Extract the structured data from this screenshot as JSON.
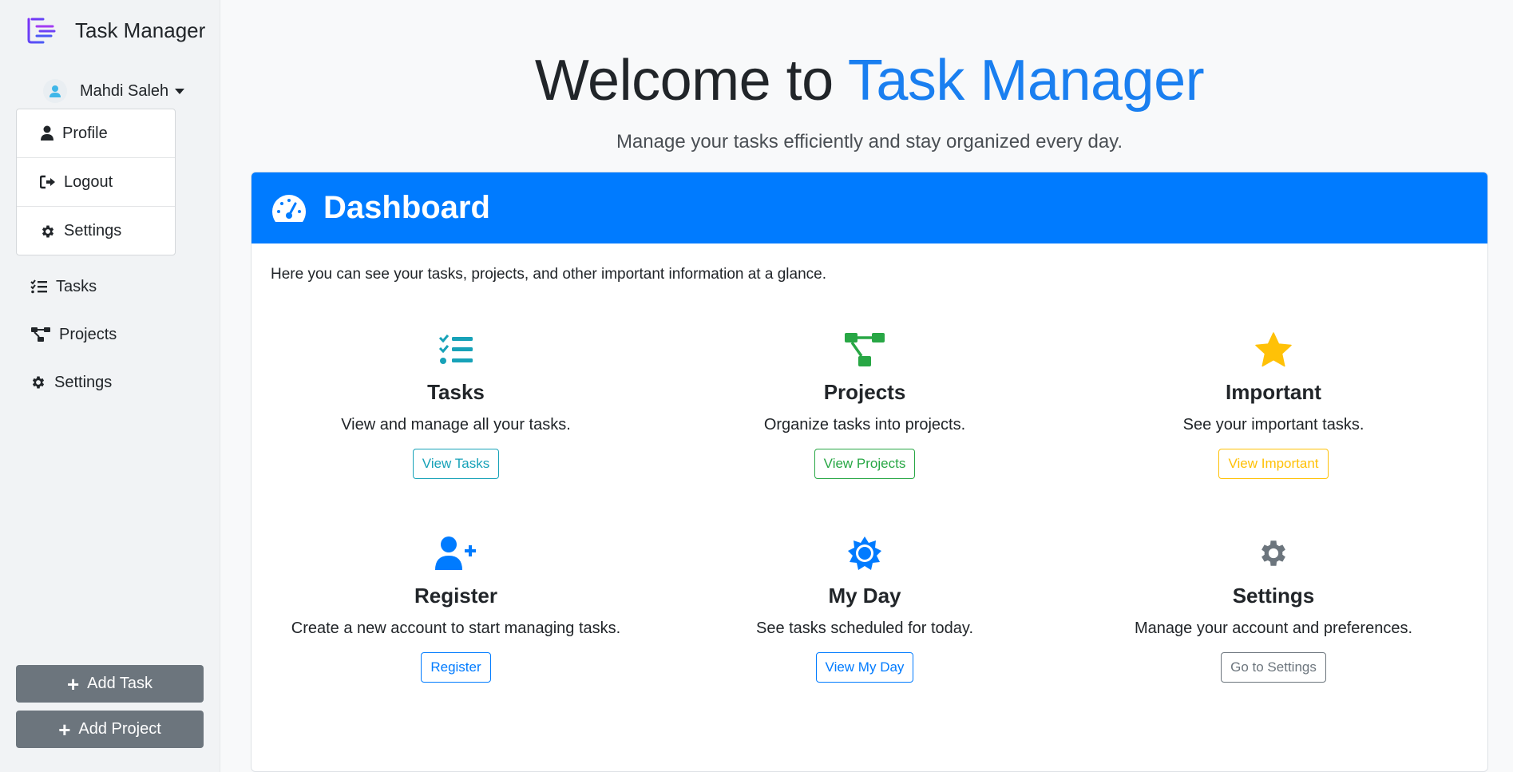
{
  "app": {
    "name": "Task Manager"
  },
  "user": {
    "name": "Mahdi Saleh"
  },
  "user_menu": [
    {
      "label": "Profile",
      "icon": "user-icon"
    },
    {
      "label": "Logout",
      "icon": "sign-out-icon"
    },
    {
      "label": "Settings",
      "icon": "gear-icon"
    }
  ],
  "nav": [
    {
      "label": "Tasks",
      "icon": "tasks-list-icon"
    },
    {
      "label": "Projects",
      "icon": "project-diagram-icon"
    },
    {
      "label": "Settings",
      "icon": "gear-icon"
    }
  ],
  "sidebar_buttons": {
    "add_task": "Add Task",
    "add_project": "Add Project"
  },
  "hero": {
    "title_prefix": "Welcome to ",
    "title_accent": "Task Manager",
    "subtitle": "Manage your tasks efficiently and stay organized every day."
  },
  "dashboard": {
    "title": "Dashboard",
    "intro": "Here you can see your tasks, projects, and other important information at a glance.",
    "features": [
      {
        "title": "Tasks",
        "description": "View and manage all your tasks.",
        "button": "View Tasks",
        "color": "#17a2b8",
        "icon": "tasks-list-icon"
      },
      {
        "title": "Projects",
        "description": "Organize tasks into projects.",
        "button": "View Projects",
        "color": "#28a745",
        "icon": "project-diagram-icon"
      },
      {
        "title": "Important",
        "description": "See your important tasks.",
        "button": "View Important",
        "color": "#ffc107",
        "icon": "star-icon"
      },
      {
        "title": "Register",
        "description": "Create a new account to start managing tasks.",
        "button": "Register",
        "color": "#007bff",
        "icon": "user-plus-icon"
      },
      {
        "title": "My Day",
        "description": "See tasks scheduled for today.",
        "button": "View My Day",
        "color": "#007bff",
        "icon": "sun-icon"
      },
      {
        "title": "Settings",
        "description": "Manage your account and preferences.",
        "button": "Go to Settings",
        "color": "#6c757d",
        "icon": "gear-icon"
      }
    ]
  },
  "colors": {
    "primary": "#007bff",
    "accent_text": "#1a7ff0",
    "secondary": "#6c757d"
  }
}
